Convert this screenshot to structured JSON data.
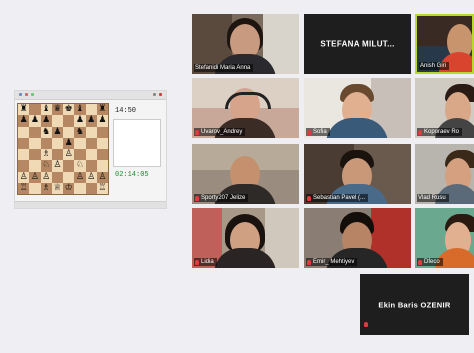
{
  "shared_screen": {
    "clock_top": "14:50",
    "clock_bottom": "02:14:05",
    "board_rows": [
      [
        "♜",
        "",
        "♝",
        "♛",
        "♚",
        "♝",
        "",
        "♜"
      ],
      [
        "♟",
        "♟",
        "♟",
        "",
        "",
        "♟",
        "♟",
        "♟"
      ],
      [
        "",
        "",
        "♞",
        "♟",
        "",
        "♞",
        "",
        ""
      ],
      [
        "",
        "",
        "",
        "",
        "♟",
        "",
        "",
        ""
      ],
      [
        "",
        "",
        "♗",
        "",
        "♙",
        "",
        "",
        ""
      ],
      [
        "",
        "",
        "♘",
        "♙",
        "",
        "♘",
        "",
        ""
      ],
      [
        "♙",
        "♙",
        "♙",
        "",
        "",
        "♙",
        "♙",
        "♙"
      ],
      [
        "♖",
        "",
        "♗",
        "♕",
        "♔",
        "",
        "",
        "♖"
      ]
    ]
  },
  "participants": [
    {
      "name": "Stefanidi Maria Anna"
    },
    {
      "name": "STEFANA MILUT...",
      "video": false
    },
    {
      "name": "Anish Giri"
    },
    {
      "name": "Uvarov_Andrey"
    },
    {
      "name": "Sofia"
    },
    {
      "name": "Koporaev Ro"
    },
    {
      "name": "Sporty207 Jelize"
    },
    {
      "name": "Sebastian Pavel (..."
    },
    {
      "name": "Vlad Rusu"
    },
    {
      "name": "Lidia"
    },
    {
      "name": "Emir_ Mehtiyev"
    },
    {
      "name": "Dfeco"
    },
    {
      "name": "Ekin Baris OZENIR",
      "video": false
    }
  ]
}
